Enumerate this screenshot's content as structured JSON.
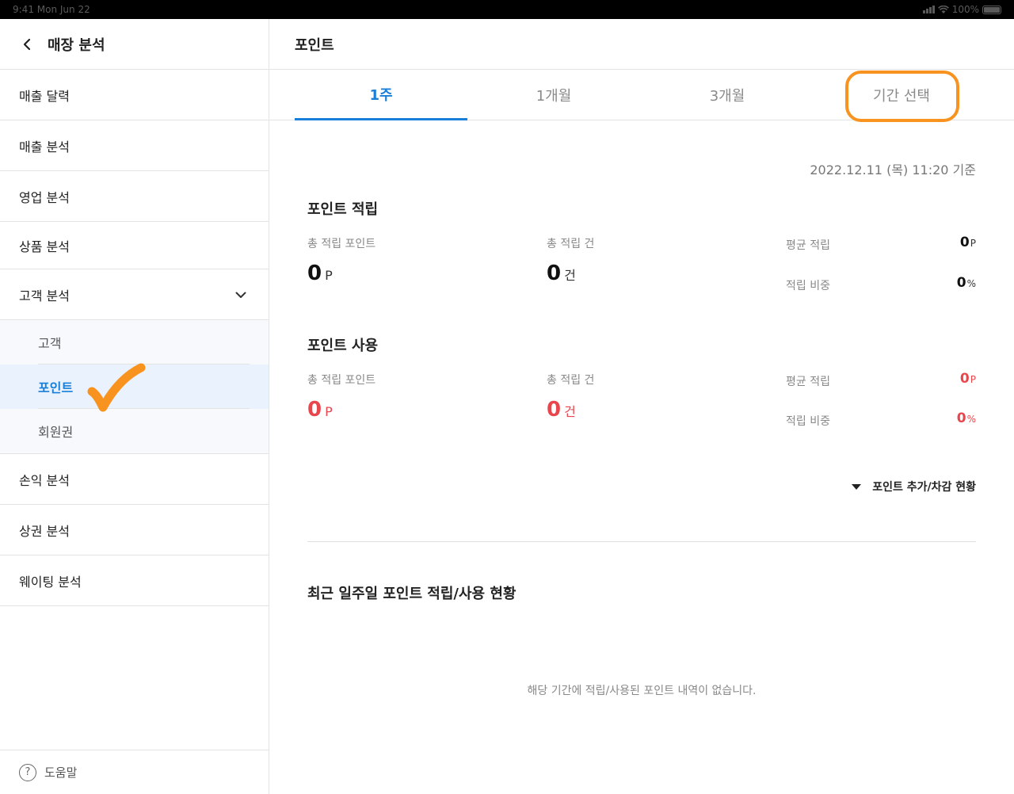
{
  "status_bar": {
    "time": "9:41  Mon Jun 22",
    "battery": "100%"
  },
  "sidebar": {
    "title": "매장 분석",
    "items": [
      {
        "label": "매출 달력"
      },
      {
        "label": "매출 분석"
      },
      {
        "label": "영업 분석"
      },
      {
        "label": "상품 분석"
      },
      {
        "label": "고객 분석"
      },
      {
        "label": "손익 분석"
      },
      {
        "label": "상권 분석"
      },
      {
        "label": "웨이팅 분석"
      }
    ],
    "sub_items": [
      {
        "label": "고객"
      },
      {
        "label": "포인트"
      },
      {
        "label": "회원권"
      }
    ],
    "help": "도움말",
    "help_icon_glyph": "?"
  },
  "main": {
    "title": "포인트",
    "tabs": [
      {
        "label": "1주"
      },
      {
        "label": "1개월"
      },
      {
        "label": "3개월"
      },
      {
        "label": "기간 선택"
      }
    ],
    "as_of": "2022.12.11 (목) 11:20 기준",
    "accrual": {
      "title": "포인트 적립",
      "total_points_label": "총 적립 포인트",
      "total_points_value": "0",
      "total_points_unit": "P",
      "total_count_label": "총 적립 건",
      "total_count_value": "0",
      "total_count_unit": "건",
      "avg_label": "평균 적립",
      "avg_value": "0",
      "avg_unit": "P",
      "ratio_label": "적립 비중",
      "ratio_value": "0",
      "ratio_unit": "%"
    },
    "usage": {
      "title": "포인트 사용",
      "total_points_label": "총 적립 포인트",
      "total_points_value": "0",
      "total_points_unit": "P",
      "total_count_label": "총 적립 건",
      "total_count_value": "0",
      "total_count_unit": "건",
      "avg_label": "평균 적립",
      "avg_value": "0",
      "avg_unit": "P",
      "ratio_label": "적립 비중",
      "ratio_value": "0",
      "ratio_unit": "%"
    },
    "toggle_label": "포인트 추가/차감 현황",
    "recent_title": "최근 일주일 포인트 적립/사용 현황",
    "empty_message": "해당 기간에 적립/사용된 포인트 내역이 없습니다."
  },
  "colors": {
    "accent": "#1a7fd8",
    "highlight": "#f7931e",
    "negative": "#e8464c"
  }
}
